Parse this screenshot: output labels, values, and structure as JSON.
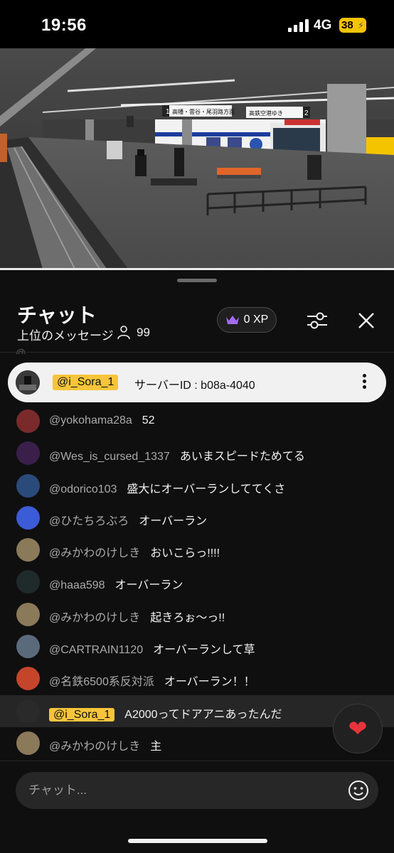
{
  "status_bar": {
    "time": "19:56",
    "network": "4G",
    "battery": "38"
  },
  "video": {
    "progress_fraction": 1.0,
    "station_signs": [
      "高幡・雲谷・尾羽路方面",
      "高鉄空港ゆき"
    ],
    "sign_numbers": [
      "1",
      "2"
    ]
  },
  "chat": {
    "title": "チャット",
    "mode_label": "上位のメッセージ",
    "viewer_count": "99",
    "xp_label": "0 XP",
    "peek_text": "@...    ...",
    "pinned": {
      "author": "@i_Sora_1",
      "text": "サーバーID : b08a-4040"
    },
    "messages": [
      {
        "author": "@yokohama28a",
        "text": "52",
        "highlight": false,
        "owner": false,
        "avatar_color": "#7a2a2a"
      },
      {
        "author": "@Wes_is_cursed_1337",
        "text": "あいまスピードためてる",
        "highlight": false,
        "owner": false,
        "avatar_color": "#3a1f4a"
      },
      {
        "author": "@odorico103",
        "text": "盛大にオーバーランしててくさ",
        "highlight": false,
        "owner": false,
        "avatar_color": "#2a4a7a"
      },
      {
        "author": "@ひたちろぶろ",
        "text": "オーバーラン",
        "highlight": false,
        "owner": false,
        "avatar_color": "#3c5bd6"
      },
      {
        "author": "@みかわのけしき",
        "text": "おいこらっ!!!!",
        "highlight": false,
        "owner": false,
        "avatar_color": "#8a7a5a"
      },
      {
        "author": "@haaa598",
        "text": "オーバーラン",
        "highlight": false,
        "owner": false,
        "avatar_color": "#1f2a2a"
      },
      {
        "author": "@みかわのけしき",
        "text": "起きろぉ〜っ!!",
        "highlight": false,
        "owner": false,
        "avatar_color": "#8a7a5a"
      },
      {
        "author": "@CARTRAIN1120",
        "text": "オーバーランして草",
        "highlight": false,
        "owner": false,
        "avatar_color": "#5a6a7a"
      },
      {
        "author": "@名鉄6500系反対派",
        "text": "オーバーラン！！",
        "highlight": false,
        "owner": false,
        "avatar_color": "#c4452a"
      },
      {
        "author": "@i_Sora_1",
        "text": "A2000ってドアアニあったんだ",
        "highlight": true,
        "owner": true,
        "avatar_color": "#2a2a2a"
      },
      {
        "author": "@みかわのけしき",
        "text": "主",
        "highlight": false,
        "owner": false,
        "avatar_color": "#8a7a5a"
      }
    ],
    "input_placeholder": "チャット...",
    "heart_icon": "heart-icon"
  }
}
